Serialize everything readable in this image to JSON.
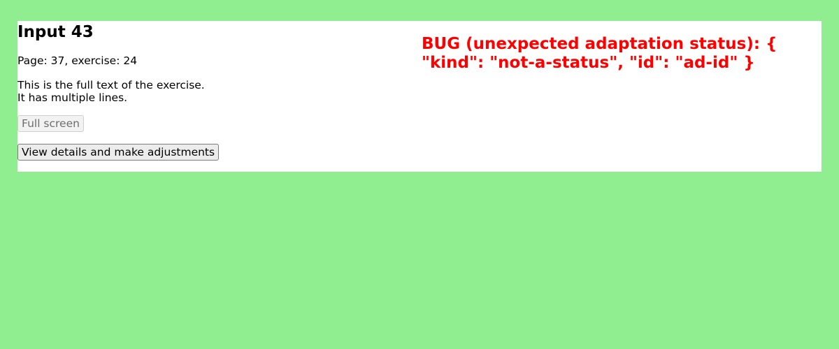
{
  "colors": {
    "background": "#90ee90",
    "panel": "#ffffff",
    "error": "#ff0000"
  },
  "header": {
    "title": "Input 43"
  },
  "exercise": {
    "page_info": "Page: 37, exercise: 24",
    "text_line_1": "This is the full text of the exercise.",
    "text_line_2": "It has multiple lines."
  },
  "buttons": {
    "full_screen": "Full screen",
    "view_details": "View details and make adjustments"
  },
  "error": {
    "message": "BUG (unexpected adaptation status): { \"kind\": \"not-a-status\", \"id\": \"ad-id\" }"
  }
}
